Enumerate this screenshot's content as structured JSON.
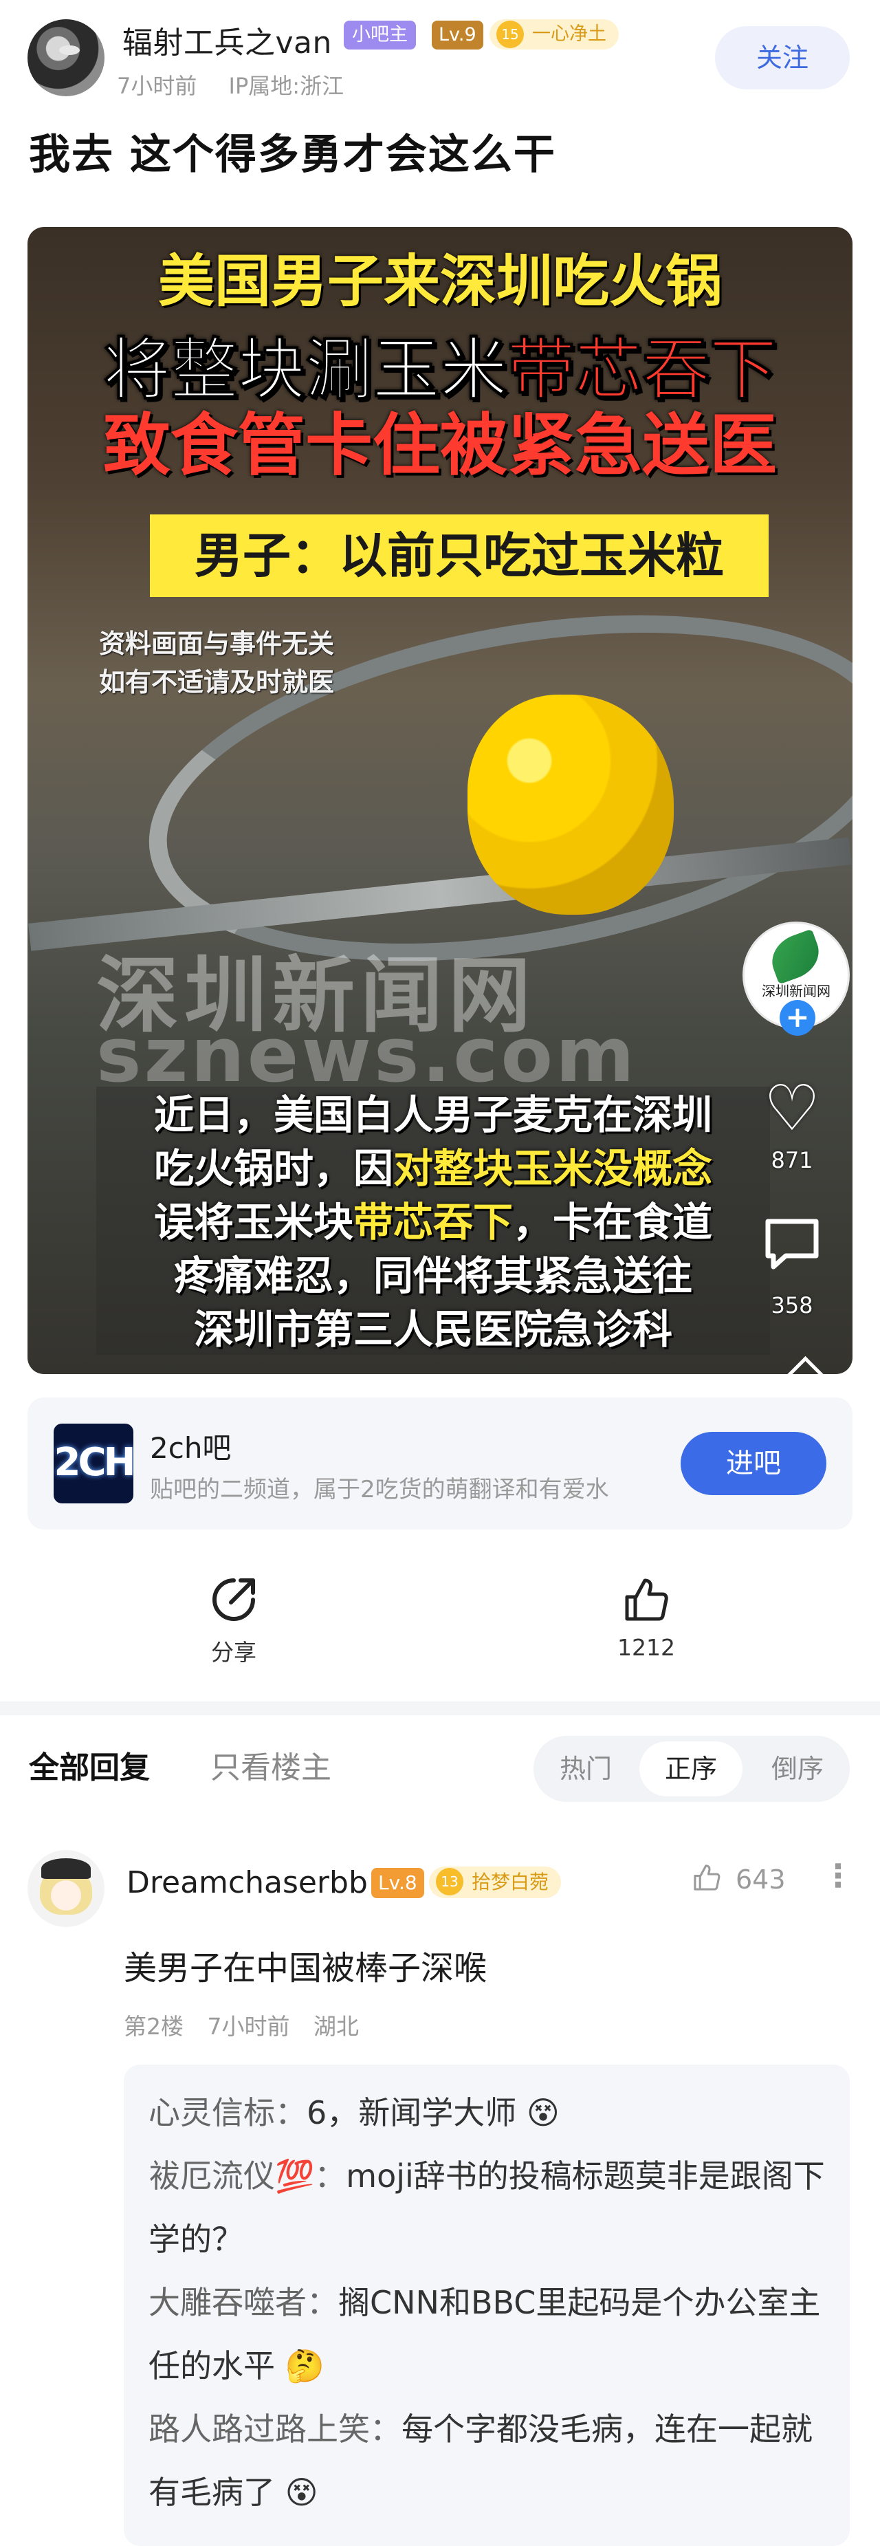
{
  "post": {
    "author": {
      "name": "辐射工兵之van",
      "role_badge": "小吧主",
      "level": "Lv.9",
      "tag_level": "15",
      "tag_text": "一心净土"
    },
    "time": "7小时前",
    "ip": "IP属地:浙江",
    "follow_label": "关注",
    "title": "我去 这个得多勇才会这么干"
  },
  "video": {
    "headline_1": "美国男子来深圳吃火锅",
    "headline_2_white": "将整块涮玉米",
    "headline_2_red": "带芯吞下",
    "headline_3": "致食管卡住被紧急送医",
    "banner": "男子：以前只吃过玉米粒",
    "disclaimer_1": "资料画面与事件无关",
    "disclaimer_2": "如有不适请及时就医",
    "watermark_cn": "深圳新闻网",
    "watermark_en": "sznews.com",
    "body_line1": "近日，美国白人男子麦克在深圳",
    "body_line2_a": "吃火锅时，因",
    "body_line2_b": "对整块玉米没概念",
    "body_line3_a": "误将玉米块",
    "body_line3_b": "带芯吞下",
    "body_line3_c": "，卡在食道",
    "body_line4": "疼痛难忍，同伴将其紧急送往",
    "body_line5": "深圳市第三人民医院急诊科",
    "channel_name": "深圳新闻网",
    "like_count": "871",
    "comment_count": "358"
  },
  "forum": {
    "logo_text": "2CH",
    "name": "2ch吧",
    "description": "贴吧的二频道，属于2吃货的萌翻译和有爱水",
    "enter_label": "进吧"
  },
  "actions": {
    "share_label": "分享",
    "like_count": "1212"
  },
  "reply_tabs": {
    "all": "全部回复",
    "op_only": "只看楼主",
    "sort_hot": "热门",
    "sort_asc": "正序",
    "sort_desc": "倒序"
  },
  "comment": {
    "user": "Dreamchaserbb",
    "level": "Lv.8",
    "tag_level": "13",
    "tag_text": "拾梦白菀",
    "likes": "643",
    "text": "美男子在中国被棒子深喉",
    "floor": "第2楼",
    "time": "7小时前",
    "location": "湖北",
    "replies": [
      {
        "name": "心灵信标",
        "text": "6，新闻学大师 😵"
      },
      {
        "name": "袚厄流仪💯",
        "text": "moji辞书的投稿标题莫非是跟阁下学的？"
      },
      {
        "name": "大雕吞噬者",
        "text": "搁CNN和BBC里起码是个办公室主任的水平 🤔"
      },
      {
        "name": "路人路过路上笑",
        "text": "每个字都没毛病，连在一起就有毛病了 😵"
      }
    ]
  }
}
